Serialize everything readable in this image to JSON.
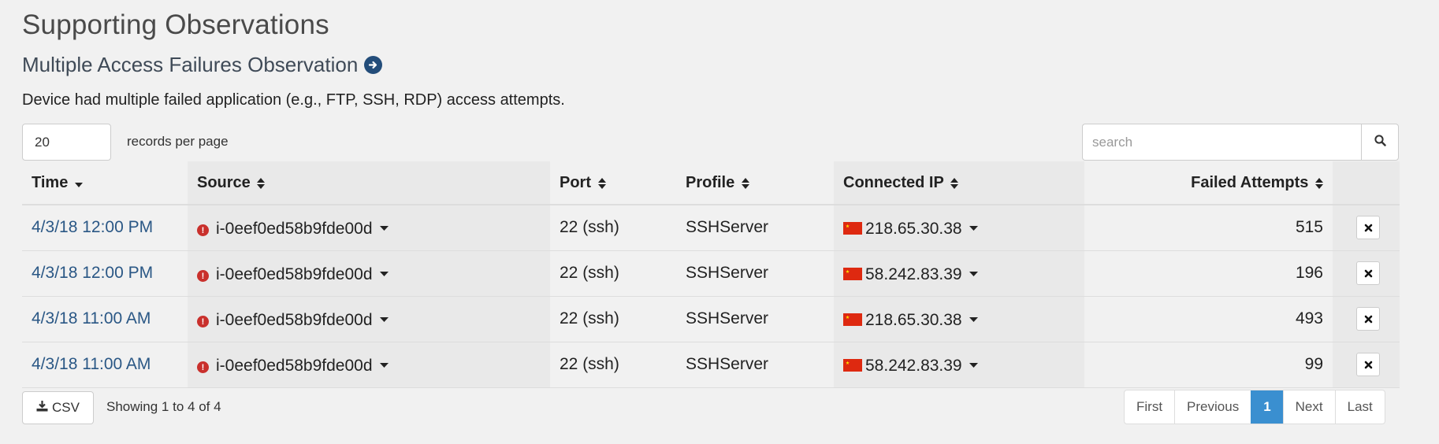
{
  "page": {
    "title": "Supporting Observations",
    "subtitle": "Multiple Access Failures Observation",
    "description": "Device had multiple failed application (e.g., FTP, SSH, RDP) access attempts."
  },
  "controls": {
    "page_length": "20",
    "page_length_label": "records per page",
    "search_placeholder": "search"
  },
  "table": {
    "headers": {
      "time": "Time",
      "source": "Source",
      "port": "Port",
      "profile": "Profile",
      "connected_ip": "Connected IP",
      "failed_attempts": "Failed Attempts"
    },
    "rows": [
      {
        "time": "4/3/18 12:00 PM",
        "source": "i-0eef0ed58b9fde00d",
        "port": "22 (ssh)",
        "profile": "SSHServer",
        "ip": "218.65.30.38",
        "failed": "515"
      },
      {
        "time": "4/3/18 12:00 PM",
        "source": "i-0eef0ed58b9fde00d",
        "port": "22 (ssh)",
        "profile": "SSHServer",
        "ip": "58.242.83.39",
        "failed": "196"
      },
      {
        "time": "4/3/18 11:00 AM",
        "source": "i-0eef0ed58b9fde00d",
        "port": "22 (ssh)",
        "profile": "SSHServer",
        "ip": "218.65.30.38",
        "failed": "493"
      },
      {
        "time": "4/3/18 11:00 AM",
        "source": "i-0eef0ed58b9fde00d",
        "port": "22 (ssh)",
        "profile": "SSHServer",
        "ip": "58.242.83.39",
        "failed": "99"
      }
    ]
  },
  "footer": {
    "csv_label": "CSV",
    "info": "Showing 1 to 4 of 4",
    "pagination": {
      "first": "First",
      "previous": "Previous",
      "current": "1",
      "next": "Next",
      "last": "Last"
    }
  },
  "colors": {
    "accent": "#3a8fd0",
    "link": "#2a5785",
    "alert": "#c9302c",
    "background": "#f1f1f1"
  },
  "icons": [
    "arrow-circle-right-icon",
    "search-icon",
    "sort-icon",
    "sort-desc-icon",
    "alert-icon",
    "caret-down-icon",
    "cn-flag-icon",
    "close-icon",
    "download-icon"
  ]
}
